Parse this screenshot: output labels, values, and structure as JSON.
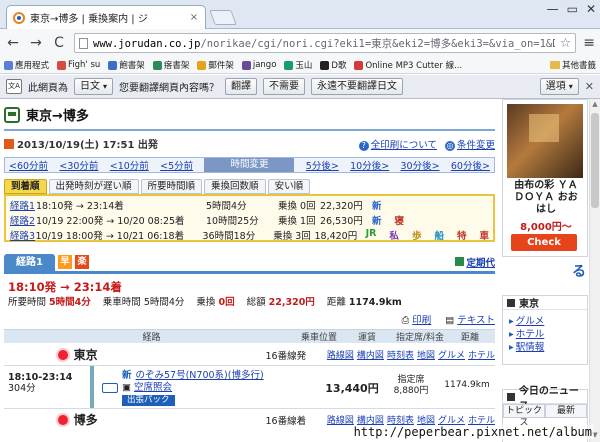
{
  "browser": {
    "tab_title": "東京→博多 | 乗換案内 | ジ",
    "tab_close": "×",
    "win_min": "—",
    "win_max": "▭",
    "win_close": "✕",
    "url_host": "www.jorudan.co.jp",
    "url_path": "/norikae/cgi/nori.cgi?eki1=東京&eki2=博多&eki3=&via_on=1&Dym:",
    "back": "←",
    "forward": "→",
    "reload": "C",
    "star": "☆",
    "menu": "≡",
    "bookmarks": [
      {
        "label": "應用程式",
        "color": "#5b7fd8"
      },
      {
        "label": "Figh' su",
        "color": "#d84a3b"
      },
      {
        "label": "飽書架",
        "color": "#3b6fc9"
      },
      {
        "label": "瘩書架",
        "color": "#2e8b57"
      },
      {
        "label": "郵件架",
        "color": "#e6a31a"
      },
      {
        "label": "jango",
        "color": "#6a4a9a"
      },
      {
        "label": "玉山",
        "color": "#1a9b6b"
      },
      {
        "label": "D歌",
        "color": "#222222"
      },
      {
        "label": "Online MP3 Cutter 線...",
        "color": "#d43a3a"
      }
    ],
    "bookmarks_other": "其他書籤"
  },
  "translate": {
    "icon_text": "文A",
    "prefix": "此網頁為",
    "lang": "日文",
    "question": "您要翻譯網頁內容嗎？",
    "translate_btn": "翻譯",
    "no_btn": "不需要",
    "never_btn": "永遠不要翻譯日文",
    "options_btn": "選項",
    "close": "✕"
  },
  "page": {
    "title": "東京→博多",
    "date_text": "2013/10/19(土) 17:51 出発",
    "print_all": "全印刷について",
    "conditions": "条件変更",
    "time_links_before": [
      "<60分前",
      "<30分前",
      "<10分前",
      "<5分前"
    ],
    "time_change": "時間変更",
    "time_links_after": [
      "5分後>",
      "10分後>",
      "30分後>",
      "60分後>"
    ],
    "sort_tabs": [
      "到着順",
      "出発時刻が遅い順",
      "所要時間順",
      "乗換回数順",
      "安い順"
    ],
    "routes": [
      {
        "name": "経路1",
        "time": "18:10発 → 23:14着",
        "duration": "5時間4分",
        "transfers": "乗換 0回",
        "fare": "22,320円",
        "marks": [
          {
            "t": "新",
            "c": "m-shin"
          }
        ]
      },
      {
        "name": "経路2",
        "time": "10/19 22:00発 → 10/20 08:25着",
        "duration": "10時間25分",
        "transfers": "乗換 1回",
        "fare": "26,530円",
        "marks": [
          {
            "t": "新",
            "c": "m-shin"
          },
          {
            "t": "寝",
            "c": "m-ner"
          }
        ]
      },
      {
        "name": "経路3",
        "time": "10/19 18:00発 → 10/21 06:18着",
        "duration": "36時間18分",
        "transfers": "乗換 3回",
        "fare": "18,420円",
        "marks": [
          {
            "t": "JR",
            "c": "m-jr"
          },
          {
            "t": "私",
            "c": "m-priv"
          },
          {
            "t": "歩",
            "c": "m-walk"
          },
          {
            "t": "船",
            "c": "m-ship"
          },
          {
            "t": "特",
            "c": "m-ner"
          },
          {
            "t": "車",
            "c": "m-ner"
          }
        ]
      }
    ],
    "route_tab": "経路1",
    "badge_haya": "早",
    "badge_raku": "楽",
    "teiki": "定期代",
    "time_big": "18:10発 → 23:14着",
    "summary": {
      "req_label": "所要時間",
      "req_value": "5時間4分",
      "ride_label": "乗車時間",
      "ride_value": "5時間4分",
      "trans_label": "乗換",
      "trans_value": "0回",
      "total_label": "総額",
      "total_value": "22,320円",
      "dist_label": "距離",
      "dist_value": "1174.9km"
    },
    "print": "印刷",
    "text_link": "テキスト",
    "table_headers": [
      "経路",
      "乗車位置",
      "運賃",
      "指定席/料金",
      "距離"
    ],
    "station_from": "東京",
    "station_to": "博多",
    "platform_from": "16番線発",
    "platform_to": "16番線着",
    "station_links": [
      "路線図",
      "構内図",
      "時刻表",
      "地図",
      "グルメ",
      "ホテル"
    ],
    "segment": {
      "time": "18:10-23:14",
      "minutes": "304分",
      "shin_mark": "新",
      "train": "のぞみ57号(N700系)(博多行)",
      "seat_info": "空席照会",
      "pack": "出張パック",
      "fare": "13,440円",
      "seat_label": "指定席",
      "seat_fee": "8,880円",
      "distance": "1174.9km"
    }
  },
  "sidebar": {
    "ad_text_1": "由布の彩 ＹＡ",
    "ad_text_2": "ＤＯＹＡ おお",
    "ad_text_3": "はし",
    "ad_price": "8,000円～",
    "ad_check": "Check",
    "logo_mark": "る",
    "station_box_title": "東京",
    "station_links": [
      "グルメ",
      "ホテル",
      "駅情報"
    ],
    "news_title": "今日のニュース",
    "news_tabs": [
      "トピックス",
      "最新"
    ]
  },
  "watermark": "http://peperbear.pixnet.net/album"
}
